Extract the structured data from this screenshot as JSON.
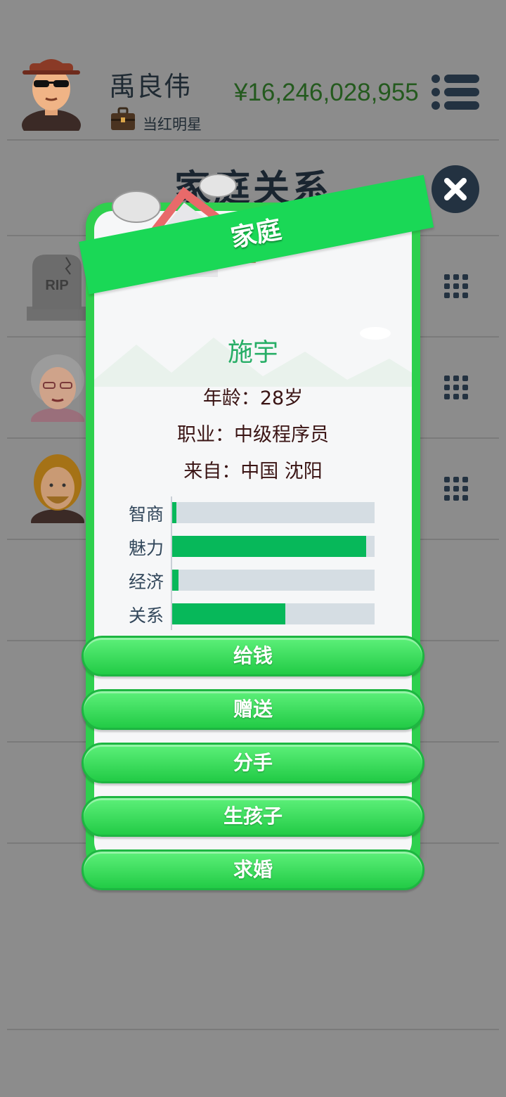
{
  "header": {
    "player_name": "禹良伟",
    "job_title": "当红明星",
    "money": "¥16,246,028,955"
  },
  "page": {
    "title": "家庭关系"
  },
  "background_rows": [
    {
      "avatar": "tombstone",
      "tombstone_text": "RIP"
    },
    {
      "avatar": "grandmother"
    },
    {
      "avatar": "blonde-man"
    }
  ],
  "card": {
    "ribbon_label": "家庭",
    "name": "施宇",
    "age": {
      "label": "年龄：",
      "value": "28岁"
    },
    "job": {
      "label": "职业：",
      "value": "中级程序员"
    },
    "origin": {
      "label": "来自：",
      "value": "中国 沈阳"
    },
    "stats": [
      {
        "label": "智商",
        "value": 0.02
      },
      {
        "label": "魅力",
        "value": 0.96
      },
      {
        "label": "经济",
        "value": 0.03
      },
      {
        "label": "关系",
        "value": 0.56
      }
    ],
    "actions": [
      "给钱",
      "赠送",
      "分手",
      "生孩子",
      "求婚"
    ]
  },
  "colors": {
    "money": "#245a1e",
    "card_border": "#2ed04e",
    "stat_fill": "#07b85a",
    "name": "#27ae66"
  }
}
